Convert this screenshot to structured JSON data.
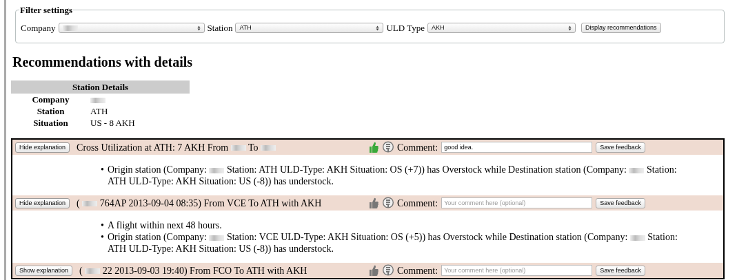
{
  "filter": {
    "legend": "Filter settings",
    "fields": [
      {
        "label": "Company",
        "value": [
          {
            "kind": "redacted"
          }
        ]
      },
      {
        "label": "Station",
        "value": [
          {
            "kind": "text",
            "text": "ATH"
          }
        ]
      },
      {
        "label": "ULD Type",
        "value": [
          {
            "kind": "text",
            "text": "AKH"
          }
        ]
      }
    ],
    "button": "Display recommendations"
  },
  "heading": "Recommendations with details",
  "station_details": {
    "title": "Station Details",
    "rows": [
      {
        "label": "Company",
        "value": [
          {
            "kind": "redacted"
          }
        ]
      },
      {
        "label": "Station",
        "value": [
          {
            "kind": "text",
            "text": "ATH"
          }
        ]
      },
      {
        "label": "Situation",
        "value": [
          {
            "kind": "text",
            "text": "US - 8 AKH"
          }
        ]
      }
    ]
  },
  "recommendations": [
    {
      "toggle": "Hide explanation",
      "expanded": true,
      "title": [
        {
          "kind": "text",
          "text": "Cross Utilization at ATH: 7 AKH From"
        },
        {
          "kind": "redacted"
        },
        {
          "kind": "text",
          "text": "To"
        },
        {
          "kind": "redacted"
        }
      ],
      "liked": true,
      "disliked": false,
      "comment_label": "Comment:",
      "comment": "good idea.",
      "save": "Save feedback",
      "explanation": [
        {
          "bullet": "•",
          "parts": [
            {
              "kind": "text",
              "text": "Origin station (Company:"
            },
            {
              "kind": "redacted"
            },
            {
              "kind": "text",
              "text": "Station: ATH ULD-Type: AKH Situation: OS (+7)) has Overstock while Destination station (Company:"
            },
            {
              "kind": "redacted"
            },
            {
              "kind": "text",
              "text": "Station: ATH ULD-Type: AKH Situation: US (-8)) has understock."
            }
          ]
        }
      ]
    },
    {
      "toggle": "Hide explanation",
      "expanded": true,
      "title": [
        {
          "kind": "text",
          "text": "("
        },
        {
          "kind": "redacted"
        },
        {
          "kind": "text",
          "text": "764AP 2013-09-04 08:35) From VCE To ATH with AKH"
        }
      ],
      "liked": false,
      "disliked": false,
      "comment_label": "Comment:",
      "placeholder": "Your comment here (optional)",
      "save": "Save feedback",
      "explanation": [
        {
          "bullet": "•",
          "parts": [
            {
              "kind": "text",
              "text": "A flight within next 48 hours."
            }
          ]
        },
        {
          "bullet": "•",
          "parts": [
            {
              "kind": "text",
              "text": "Origin station (Company:"
            },
            {
              "kind": "redacted"
            },
            {
              "kind": "text",
              "text": "Station: VCE ULD-Type: AKH Situation: OS (+5)) has Overstock while Destination station (Company:"
            },
            {
              "kind": "redacted"
            },
            {
              "kind": "text",
              "text": "Station: ATH ULD-Type: AKH Situation: US (-8)) has understock."
            }
          ]
        }
      ]
    },
    {
      "toggle": "Show explanation",
      "expanded": false,
      "title": [
        {
          "kind": "text",
          "text": "("
        },
        {
          "kind": "redacted"
        },
        {
          "kind": "text",
          "text": "22 2013-09-03 19:40) From FCO To ATH with AKH"
        }
      ],
      "liked": false,
      "disliked": false,
      "comment_label": "Comment:",
      "placeholder": "Your comment here (optional)",
      "save": "Save feedback"
    }
  ]
}
